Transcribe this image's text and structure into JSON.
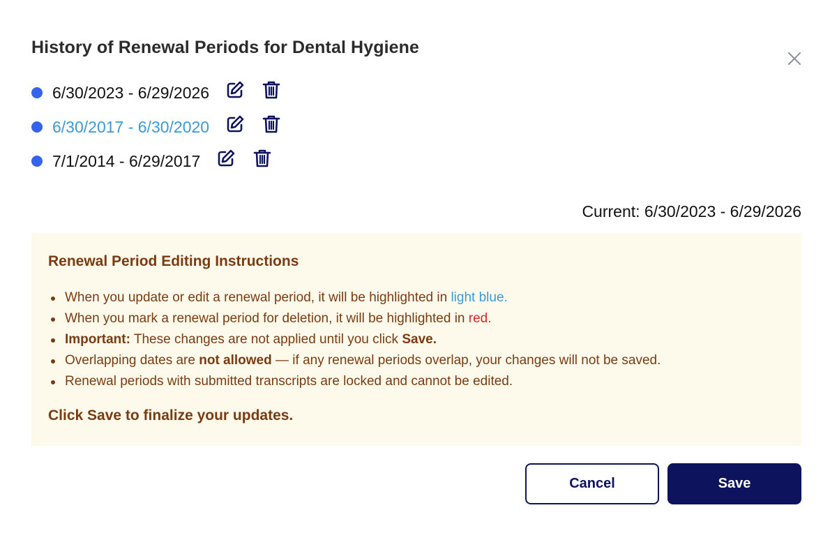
{
  "modal": {
    "title": "History of Renewal Periods for Dental Hygiene",
    "close_icon": "close-icon"
  },
  "periods": [
    {
      "range": "6/30/2023 - 6/29/2026",
      "state": "normal"
    },
    {
      "range": "6/30/2017 - 6/30/2020",
      "state": "edited"
    },
    {
      "range": "7/1/2014 - 6/29/2017",
      "state": "normal"
    }
  ],
  "period_icons": {
    "edit": "edit-icon",
    "delete": "trash-icon"
  },
  "current": "Current: 6/30/2023 - 6/29/2026",
  "instructions": {
    "title": "Renewal Period Editing Instructions",
    "items": [
      {
        "pre": "When you update or edit a renewal period, it will be highlighted in ",
        "highlight": "light blue."
      },
      {
        "pre": "When you mark a renewal period for deletion, it will be highlighted in ",
        "highlight": "red."
      },
      {
        "bold1": "Important:",
        "mid": " These changes are not applied until you click ",
        "bold2": "Save."
      },
      {
        "pre": "Overlapping dates are ",
        "bold": "not allowed",
        "post": " — if any renewal periods overlap, your changes will not be saved."
      },
      {
        "text": "Renewal periods with submitted transcripts are locked and cannot be edited."
      }
    ],
    "footer": "Click Save to finalize your updates."
  },
  "buttons": {
    "cancel": "Cancel",
    "save": "Save"
  },
  "colors": {
    "dot": "#3563e9",
    "edited_text": "#3a9ad9",
    "delete_text": "#e02424",
    "instructions_bg": "#fefaeb",
    "instructions_text": "#7a3b12",
    "primary": "#0e135e"
  }
}
